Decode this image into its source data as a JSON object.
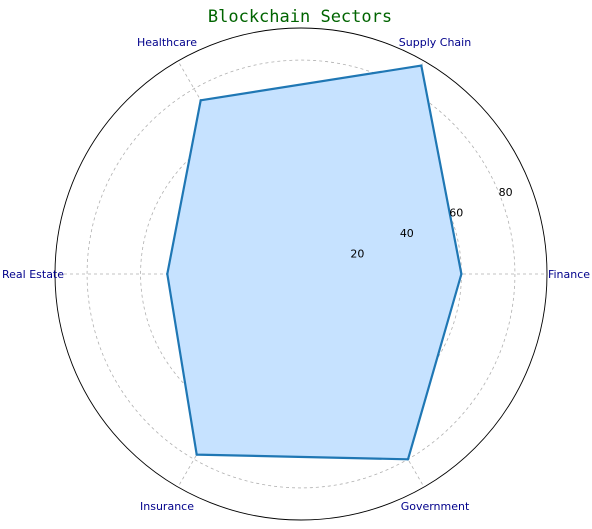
{
  "chart_data": {
    "type": "radar",
    "title": "Blockchain Sectors",
    "categories": [
      "Finance",
      "Supply Chain",
      "Healthcare",
      "Real Estate",
      "Insurance",
      "Government"
    ],
    "series": [
      {
        "values": [
          60,
          90,
          75,
          50,
          78,
          80
        ]
      }
    ],
    "r_ticks": [
      "20",
      "40",
      "60",
      "80"
    ],
    "r_tick_values": [
      20,
      40,
      60,
      80
    ],
    "rlim": [
      0,
      92
    ],
    "grid": true,
    "legend": false,
    "colors": {
      "line": "#1f77b4",
      "fill": "#c6e2ff",
      "title": "#006400",
      "category_label": "#00008b",
      "grid": "#b0b0b0",
      "outline": "#000000"
    }
  }
}
